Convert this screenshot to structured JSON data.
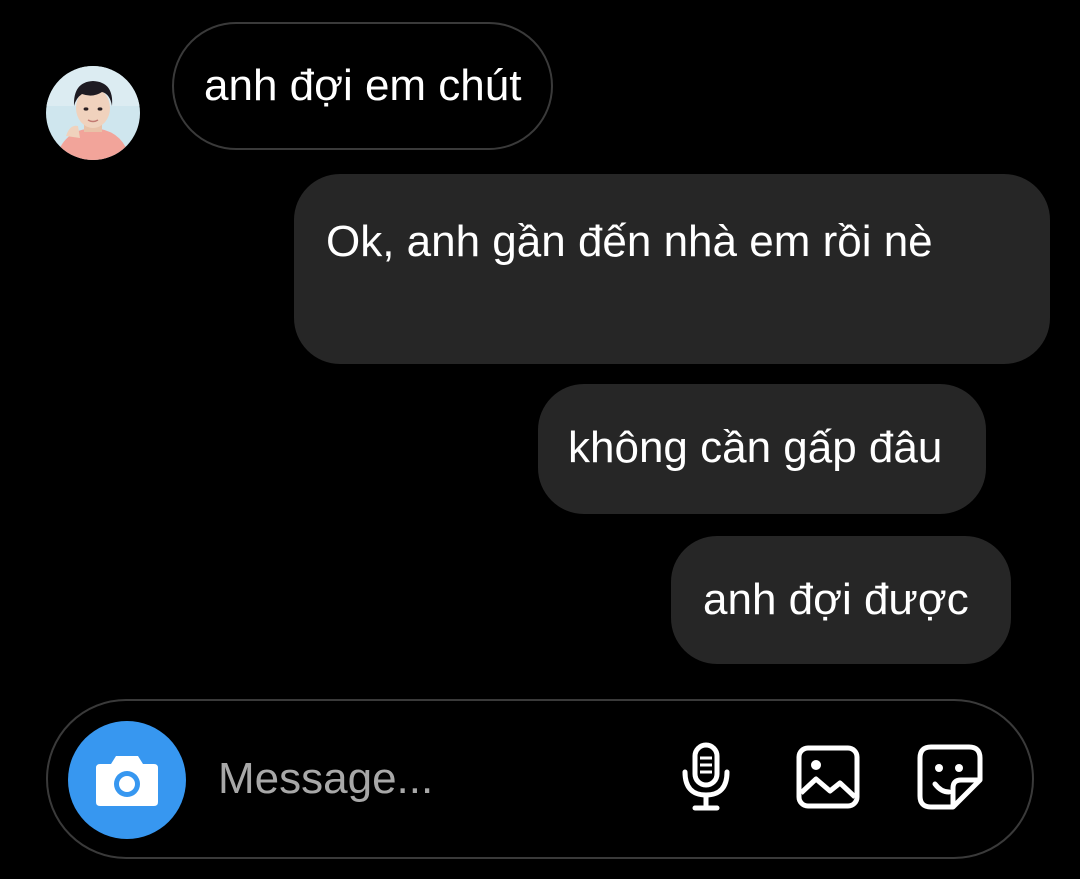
{
  "conversation": {
    "contact_avatar_icon": "contact-avatar",
    "messages": [
      {
        "sender": "contact",
        "text": "anh đợi em chút"
      },
      {
        "sender": "me",
        "text": "Ok, anh gần đến nhà em rồi nè"
      },
      {
        "sender": "me",
        "text": "không cần gấp đâu"
      },
      {
        "sender": "me",
        "text": "anh đợi được"
      }
    ]
  },
  "composer": {
    "placeholder": "Message...",
    "value": "",
    "icons": {
      "camera": "camera-icon",
      "mic": "microphone-icon",
      "gallery": "image-gallery-icon",
      "sticker": "sticker-icon"
    }
  },
  "colors": {
    "background": "#000000",
    "outgoing_bubble": "#262626",
    "incoming_border": "#3a3a3a",
    "accent": "#3797f0",
    "placeholder": "#a8a8a8"
  }
}
